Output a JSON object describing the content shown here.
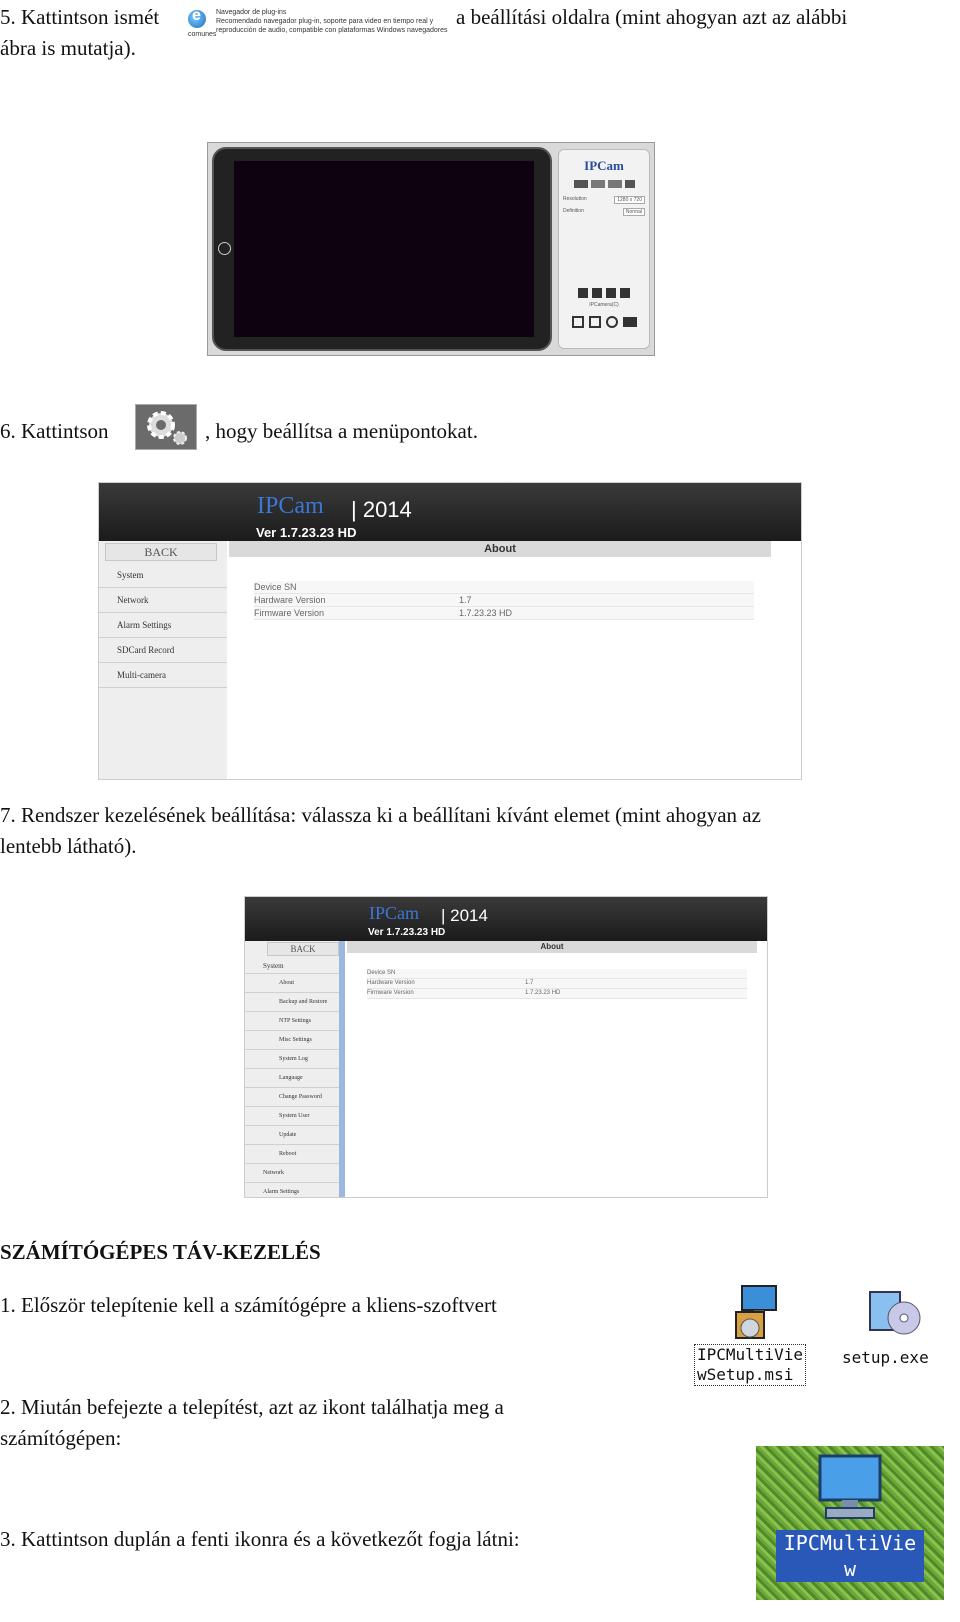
{
  "step5": {
    "text_before": "5. Kattintson ismét",
    "text_after": "a beállítási oldalra (mint ahogyan azt az alábbi",
    "text_line2": "ábra is mutatja).",
    "plugin": {
      "title": "Navegador de plug-ins",
      "desc1": "Recomendado navegador plug-in, soporte para video en tiempo real y",
      "desc2": "reproducción de audio, compatible con plataformas Windows navegadores",
      "desc3": "comunes"
    }
  },
  "cam_view": {
    "logo": "IPCam",
    "resolution_label": "Resolution",
    "resolution_value": "1280 x 720",
    "definition_label": "Definition",
    "definition_value": "Normal",
    "ipcam_caption": "IPCamera(C)"
  },
  "step6": {
    "text_before": "6. Kattintson",
    "text_after": ", hogy beállítsa a menüpontokat."
  },
  "settings1": {
    "logo": "IPCam",
    "year": "| 2014",
    "version": "Ver  1.7.23.23 HD",
    "back": "BACK",
    "tab": "About",
    "menu": [
      "System",
      "Network",
      "Alarm Settings",
      "SDCard Record",
      "Multi-camera"
    ],
    "rows": [
      {
        "label": "Device SN",
        "value": ""
      },
      {
        "label": "Hardware Version",
        "value": "1.7"
      },
      {
        "label": "Firmware Version",
        "value": "1.7.23.23 HD"
      }
    ]
  },
  "step7": {
    "line1": "7. Rendszer kezelésének beállítása: válassza ki a beállítani kívánt elemet (mint ahogyan az",
    "line2": "lentebb látható)."
  },
  "settings2": {
    "logo": "IPCam",
    "year": "| 2014",
    "version": "Ver  1.7.23.23 HD",
    "back": "BACK",
    "tab": "About",
    "system": "System",
    "submenu": [
      "About",
      "Backup and Restore",
      "NTP Settings",
      "Misc Settings",
      "System Log",
      "Language",
      "Change Password",
      "System User",
      "Update",
      "Reboot"
    ],
    "menu_after": [
      "Network",
      "Alarm Settings"
    ],
    "rows": [
      {
        "label": "Device SN",
        "value": ""
      },
      {
        "label": "Hardware Version",
        "value": "1.7"
      },
      {
        "label": "Firmware Version",
        "value": "1.7.23.23 HD"
      }
    ]
  },
  "remote": {
    "heading": "SZÁMÍTÓGÉPES TÁV-KEZELÉS",
    "step1": "1. Először telepítenie kell a számítógépre a kliens-szoftvert",
    "step2_line1": "2. Miután befejezte a telepítést, azt az ikont találhatja meg a",
    "step2_line2": "számítógépen:",
    "step3": "3.  Kattintson duplán a fenti ikonra és a következőt fogja látni:",
    "file1_line1": "IPCMultiVie",
    "file1_line2": "wSetup.msi",
    "file2": "setup.exe",
    "desktop_icon_line1": "IPCMultiVie",
    "desktop_icon_line2": "w"
  }
}
